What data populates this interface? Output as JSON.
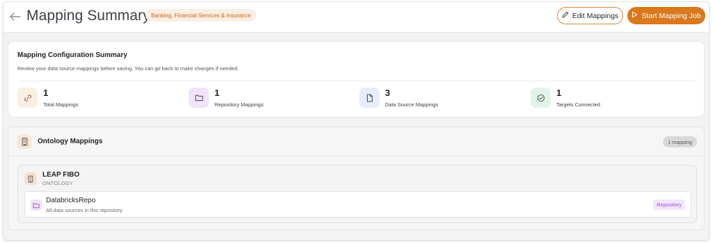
{
  "header": {
    "title": "Mapping Summary",
    "industry_badge": "Banking, Financial Services & Insurance",
    "edit_button": "Edit Mappings",
    "start_button": "Start Mapping Job"
  },
  "summary": {
    "title": "Mapping Configuration Summary",
    "description": "Review your data source mappings before saving. You can go back to make changes if needed.",
    "stats": [
      {
        "value": "1",
        "label": "Total Mappings",
        "icon": "link-icon",
        "color": "#fbeee2"
      },
      {
        "value": "1",
        "label": "Repository Mappings",
        "icon": "folder-icon",
        "color": "#f1e3fa"
      },
      {
        "value": "3",
        "label": "Data Source Mappings",
        "icon": "document-icon",
        "color": "#e6eefa"
      },
      {
        "value": "1",
        "label": "Targets Connected",
        "icon": "check-circle-icon",
        "color": "#e2f4ea"
      }
    ]
  },
  "ontology": {
    "title": "Ontology Mappings",
    "count_badge": "1 mapping",
    "entries": [
      {
        "name": "LEAP FIBO",
        "type": "ONTOLOGY",
        "repositories": [
          {
            "name": "DatabricksRepo",
            "description": "All data sources in this repository",
            "badge": "Repository"
          }
        ]
      }
    ]
  },
  "colors": {
    "accent": "#d9781c",
    "accent_border": "#d28a3b",
    "repository_badge_text": "#9b4fd1"
  }
}
